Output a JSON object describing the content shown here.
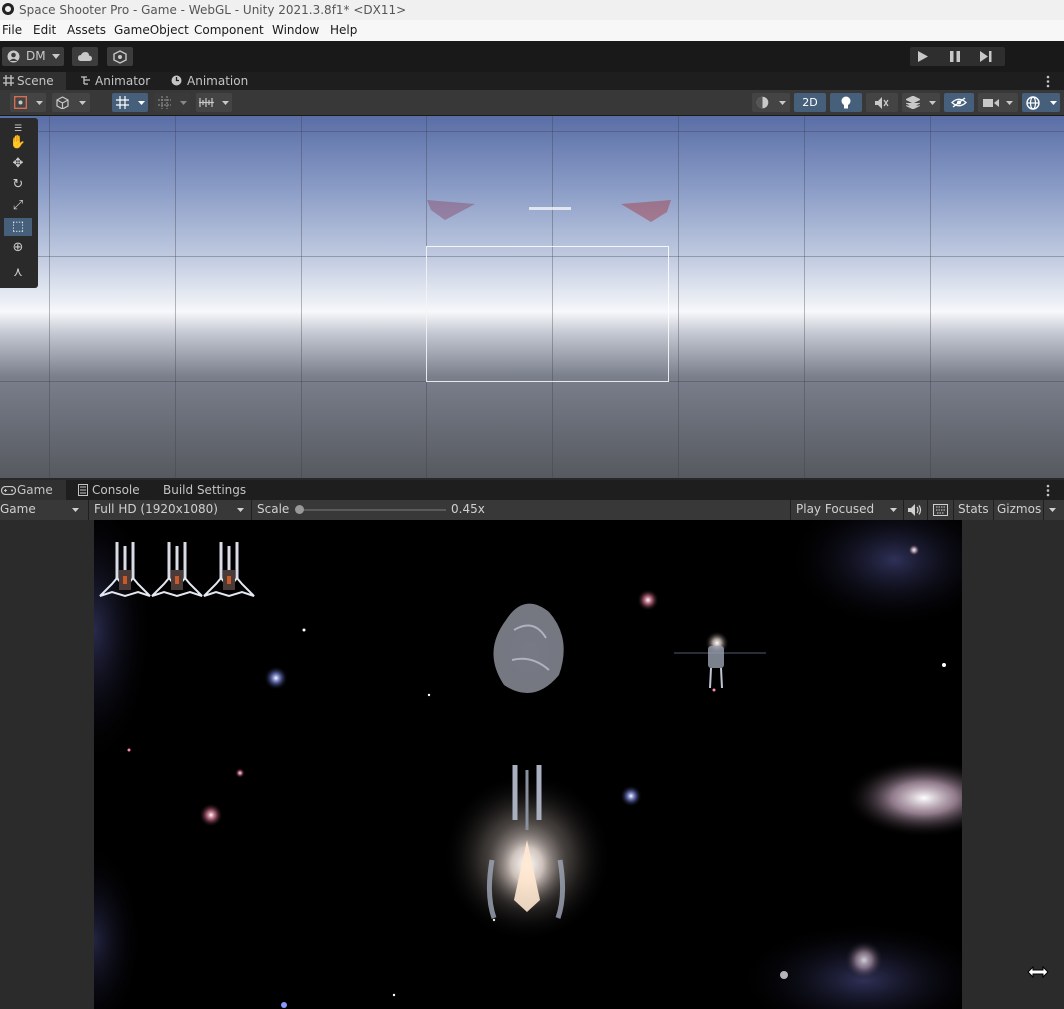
{
  "window": {
    "title": "Space Shooter Pro - Game - WebGL - Unity 2021.3.8f1* <DX11>"
  },
  "menu": [
    "File",
    "Edit",
    "Assets",
    "GameObject",
    "Component",
    "Window",
    "Help"
  ],
  "toolbar": {
    "account_label": "DM"
  },
  "scene_tabs": [
    "Scene",
    "Animator",
    "Animation"
  ],
  "scene_toolbar": {
    "mode_2d_label": "2D"
  },
  "game_tabs": [
    "Game",
    "Console",
    "Build Settings"
  ],
  "game_toolbar": {
    "display": "Game",
    "resolution": "Full HD (1920x1080)",
    "scale_label": "Scale",
    "scale_value": "0.45x",
    "scale_fraction": 0.0,
    "play_mode": "Play Focused",
    "stats_label": "Stats",
    "gizmos_label": "Gizmos"
  },
  "game": {
    "lives_count": 3
  },
  "colors": {
    "accent": "#46607c",
    "panel": "#383838",
    "background": "#282828"
  }
}
